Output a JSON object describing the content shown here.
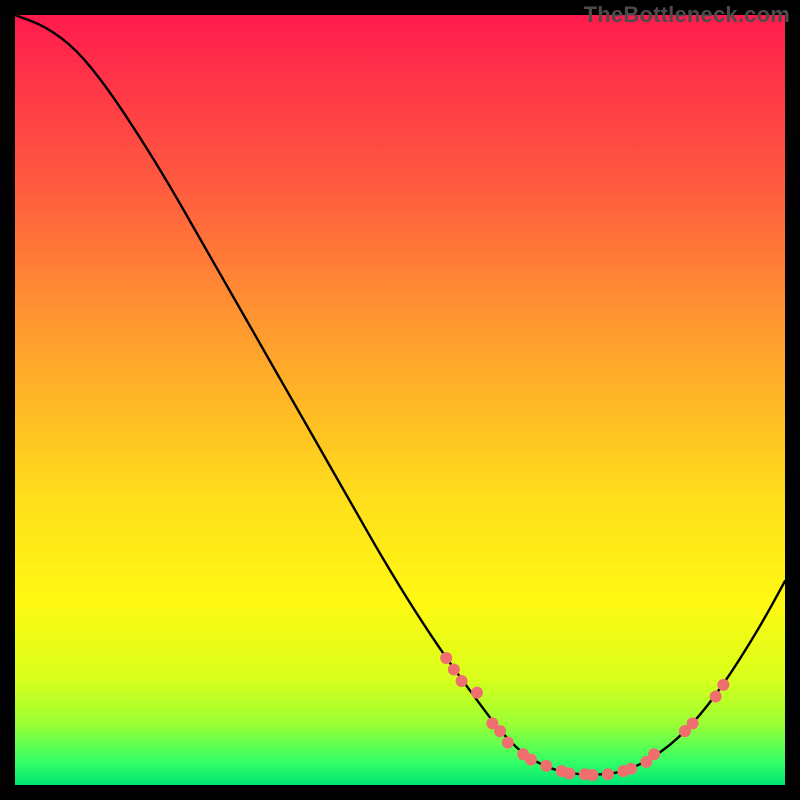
{
  "watermark": "TheBottleneck.com",
  "colors": {
    "frame_bg": "#000000",
    "curve": "#000000",
    "marker": "#ef6e6e",
    "gradient_top": "#ff1a4d",
    "gradient_bottom": "#00e673"
  },
  "chart_data": {
    "type": "line",
    "title": "",
    "xlabel": "",
    "ylabel": "",
    "xlim": [
      0,
      100
    ],
    "ylim": [
      0,
      100
    ],
    "grid": false,
    "legend": false,
    "x": [
      0,
      4,
      8,
      12,
      16,
      20,
      24,
      28,
      32,
      36,
      40,
      44,
      48,
      52,
      56,
      60,
      63,
      66,
      69,
      72,
      75,
      78,
      81,
      85,
      89,
      93,
      97,
      100
    ],
    "y": [
      100,
      98.5,
      95.5,
      90.5,
      84.5,
      78,
      71,
      64,
      57,
      50,
      43,
      36,
      29,
      22.5,
      16.5,
      11,
      7,
      4,
      2.3,
      1.5,
      1.3,
      1.5,
      2.5,
      5,
      9,
      14.5,
      21,
      26.5
    ],
    "markers": [
      {
        "x": 56,
        "y": 16.5
      },
      {
        "x": 57,
        "y": 15
      },
      {
        "x": 58,
        "y": 13.5
      },
      {
        "x": 60,
        "y": 12
      },
      {
        "x": 62,
        "y": 8
      },
      {
        "x": 63,
        "y": 7
      },
      {
        "x": 64,
        "y": 5.5
      },
      {
        "x": 66,
        "y": 4
      },
      {
        "x": 67,
        "y": 3.3
      },
      {
        "x": 69,
        "y": 2.5
      },
      {
        "x": 71,
        "y": 1.8
      },
      {
        "x": 72,
        "y": 1.5
      },
      {
        "x": 74,
        "y": 1.4
      },
      {
        "x": 75,
        "y": 1.3
      },
      {
        "x": 77,
        "y": 1.4
      },
      {
        "x": 79,
        "y": 1.8
      },
      {
        "x": 80,
        "y": 2.1
      },
      {
        "x": 82,
        "y": 3
      },
      {
        "x": 83,
        "y": 4
      },
      {
        "x": 87,
        "y": 7
      },
      {
        "x": 88,
        "y": 8
      },
      {
        "x": 91,
        "y": 11.5
      },
      {
        "x": 92,
        "y": 13
      }
    ],
    "marker_radius": 6
  }
}
